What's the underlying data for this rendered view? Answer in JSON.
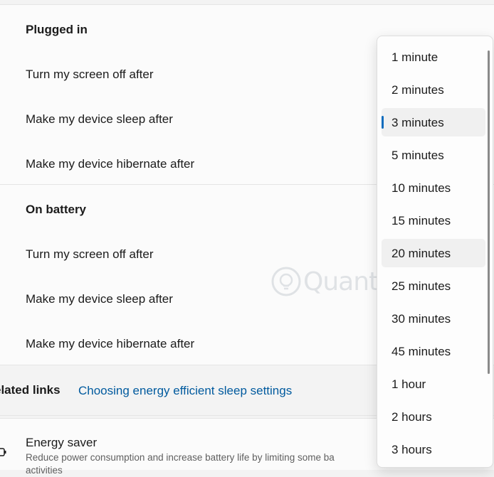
{
  "plugged_in": {
    "title": "Plugged in",
    "rows": [
      "Turn my screen off after",
      "Make my device sleep after",
      "Make my device hibernate after"
    ]
  },
  "on_battery": {
    "title": "On battery",
    "rows": [
      "Turn my screen off after",
      "Make my device sleep after",
      "Make my device hibernate after"
    ]
  },
  "related": {
    "label": "elated links",
    "link": "Choosing energy efficient sleep settings"
  },
  "energy_saver": {
    "title": "Energy saver",
    "description": "Reduce power consumption and increase battery life by limiting some ba",
    "description_line2": "activities"
  },
  "dropdown": {
    "options": [
      "1 minute",
      "2 minutes",
      "3 minutes",
      "5 minutes",
      "10 minutes",
      "15 minutes",
      "20 minutes",
      "25 minutes",
      "30 minutes",
      "45 minutes",
      "1 hour",
      "2 hours",
      "3 hours"
    ],
    "selected": "3 minutes",
    "hovered": "20 minutes"
  },
  "watermark": {
    "text": "Quantrimang"
  },
  "colors": {
    "accent": "#0f6cbd",
    "link": "#005a9e"
  }
}
